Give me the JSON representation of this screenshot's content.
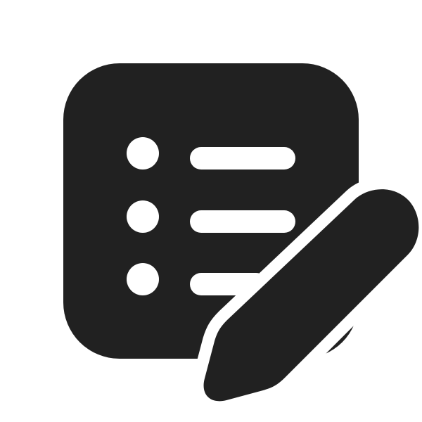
{
  "icon": {
    "name": "task-list-edit-icon",
    "description_color": "#212121",
    "background": "#ffffff",
    "list_rows": 3
  }
}
